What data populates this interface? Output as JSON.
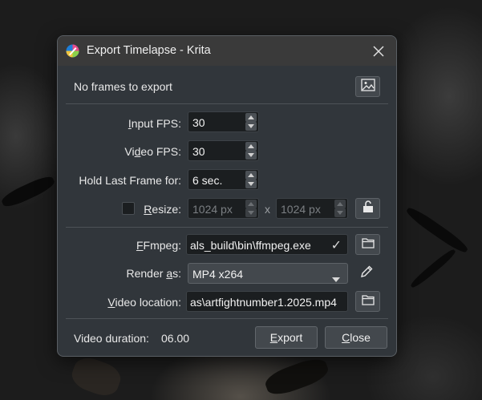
{
  "window": {
    "title": "Export Timelapse - Krita"
  },
  "status": {
    "message": "No frames to export"
  },
  "fields": {
    "input_fps": {
      "label_pre": "",
      "label_mnemonic": "I",
      "label_post": "nput FPS:",
      "value": "30"
    },
    "video_fps": {
      "label_pre": "Vi",
      "label_mnemonic": "d",
      "label_post": "eo FPS:",
      "value": "30"
    },
    "hold_last_frame": {
      "label": "Hold Last Frame for:",
      "value": "6 sec."
    },
    "resize": {
      "label_pre": "",
      "label_mnemonic": "R",
      "label_post": "esize:",
      "checked": false,
      "width": "1024 px",
      "separator": "x",
      "height": "1024 px"
    },
    "ffmpeg": {
      "label_pre": "",
      "label_mnemonic": "F",
      "label_post": "Fmpeg:",
      "value": "als_build\\bin\\ffmpeg.exe",
      "valid_mark": "✓"
    },
    "render_as": {
      "label_pre": "Render ",
      "label_mnemonic": "a",
      "label_post": "s:",
      "value": "MP4 x264"
    },
    "video_location": {
      "label_pre": "",
      "label_mnemonic": "V",
      "label_post": "ideo location:",
      "value": "as\\artfightnumber1.2025.mp4"
    }
  },
  "footer": {
    "duration_label": "Video duration:",
    "duration_value": "06.00",
    "export_pre": "",
    "export_mnemonic": "E",
    "export_post": "xport",
    "close_pre": "",
    "close_mnemonic": "C",
    "close_post": "lose"
  },
  "icons": {
    "app": "krita-logo-icon",
    "close": "close-icon",
    "preview": "image-icon",
    "lock": "aspect-lock-icon",
    "folder": "folder-icon",
    "edit": "pencil-icon"
  },
  "colors": {
    "dialog_bg": "#31363b",
    "input_bg": "#1b1e20",
    "button_bg": "#43484d",
    "text": "#e8e8e8"
  }
}
